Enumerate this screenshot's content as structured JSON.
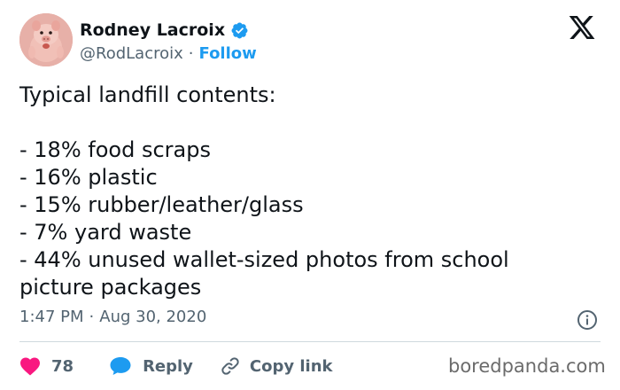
{
  "author": {
    "display_name": "Rodney Lacroix",
    "handle": "@RodLacroix",
    "separator": "·",
    "follow_label": "Follow",
    "verified_color": "#1d9bf0"
  },
  "tweet": {
    "lines": [
      "Typical landfill contents:",
      "",
      "- 18% food scraps",
      "- 16% plastic",
      "- 15% rubber/leather/glass",
      "- 7% yard waste",
      "- 44% unused wallet-sized photos from school",
      "picture packages"
    ]
  },
  "meta": {
    "time": "1:47 PM",
    "separator": "·",
    "date": "Aug 30, 2020"
  },
  "actions": {
    "like_count": "78",
    "reply_label": "Reply",
    "copy_link_label": "Copy link"
  },
  "watermark": "boredpanda.com",
  "colors": {
    "accent": "#1d9bf0",
    "like": "#f91880",
    "muted": "#536471"
  },
  "icons": [
    "x-logo-icon",
    "verified-badge-icon",
    "info-icon",
    "heart-icon",
    "reply-icon",
    "link-icon"
  ]
}
